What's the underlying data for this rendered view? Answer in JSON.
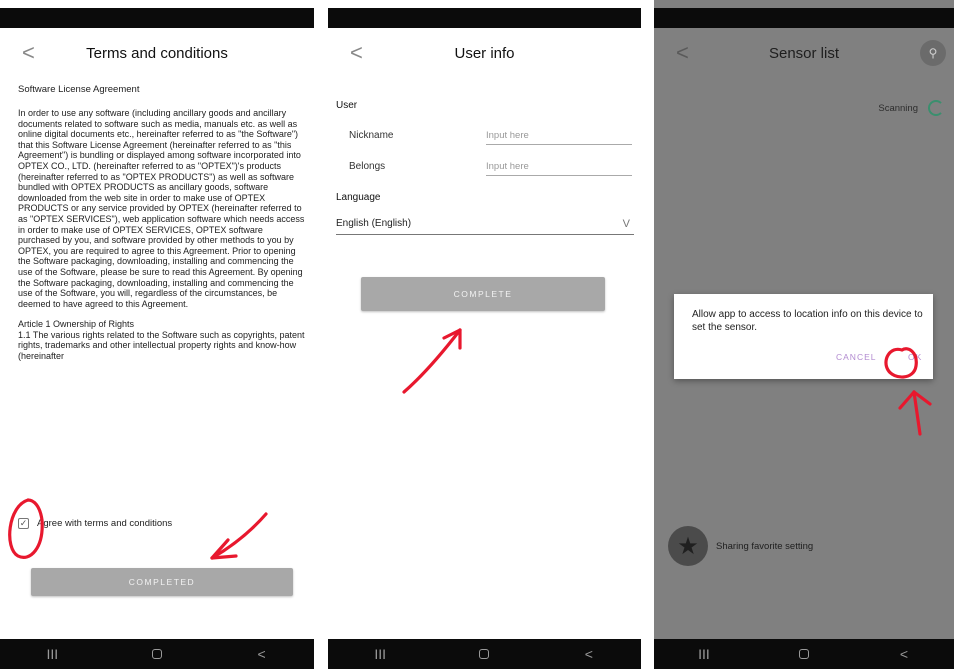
{
  "panel1": {
    "header": {
      "back": "<",
      "title": "Terms and conditions"
    },
    "subtitle": "Software License Agreement",
    "paragraph1": "In order to use any software (including ancillary goods and ancillary documents related to software such as media, manuals etc. as well as online digital documents etc., hereinafter referred to as \"the Software\") that this Software License Agreement (hereinafter referred to as \"this Agreement\") is bundling or displayed among software incorporated into OPTEX CO., LTD. (hereinafter referred to as \"OPTEX\")'s products (hereinafter referred to as \"OPTEX PRODUCTS\") as well as software bundled with OPTEX PRODUCTS as ancillary goods, software downloaded from the web site in order to make use of OPTEX PRODUCTS or any service provided by OPTEX (hereinafter referred to as \"OPTEX SERVICES\"), web application software which needs access in order to make use of OPTEX SERVICES, OPTEX software purchased by you, and software provided by other methods to you by OPTEX, you are required to agree to this Agreement. Prior to opening the Software packaging, downloading, installing and commencing the use of the Software, please be sure to read this Agreement. By opening the Software packaging, downloading, installing and commencing the use of the Software, you will, regardless of the circumstances, be deemed to have agreed to this Agreement.",
    "paragraph2": "Article 1  Ownership of Rights\n1.1 The various rights related to the Software such as copyrights, patent rights, trademarks and other intellectual property rights and know-how (hereinafter",
    "checkbox_mark": "✓",
    "agree_label": "Agree with terms and conditions",
    "button": "COMPLETED"
  },
  "panel2": {
    "header": {
      "back": "<",
      "title": "User info"
    },
    "section_user": "User",
    "nickname_label": "Nickname",
    "nickname_placeholder": "Input here",
    "belongs_label": "Belongs",
    "belongs_placeholder": "Input here",
    "section_language": "Language",
    "language_value": "English (English)",
    "dropdown_arrow": "V",
    "button": "COMPLETE"
  },
  "panel3": {
    "header": {
      "back": "<",
      "title": "Sensor list"
    },
    "share_icon_glyph": "⚲",
    "scanning": "Scanning",
    "dialog": {
      "message": "Allow app to access to location info on this device to set the sensor.",
      "cancel": "CANCEL",
      "ok": "OK"
    },
    "favorite_icon_glyph": "★",
    "favorite_label": "Sharing favorite setting"
  },
  "navbar": {
    "recents": "III",
    "back": "<"
  },
  "colors": {
    "annotation": "#e8182e",
    "button_gray": "#a8a8a8",
    "overlay": "#808080",
    "dialog_accent": "#b28ad0"
  }
}
